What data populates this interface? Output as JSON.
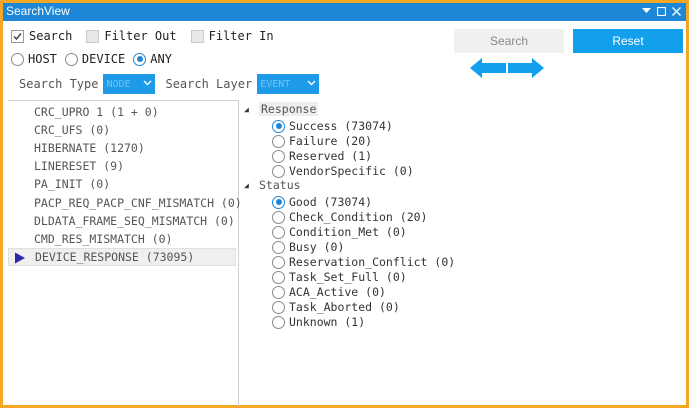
{
  "window": {
    "title": "SearchView"
  },
  "options": {
    "search": {
      "label": "Search",
      "checked": true
    },
    "filter_out": {
      "label": "Filter Out",
      "checked": false
    },
    "filter_in": {
      "label": "Filter In",
      "checked": false
    }
  },
  "scope": {
    "host": "HOST",
    "device": "DEVICE",
    "any": "ANY",
    "selected": "ANY"
  },
  "search_type": {
    "label": "Search Type",
    "value": "NODE"
  },
  "search_layer": {
    "label": "Search Layer",
    "value": "EVENT"
  },
  "buttons": {
    "search": "Search",
    "reset": "Reset"
  },
  "events": [
    {
      "label": "CRC_UPRO 1 (1 + 0)"
    },
    {
      "label": "CRC_UFS (0)"
    },
    {
      "label": "HIBERNATE (1270)"
    },
    {
      "label": "LINERESET (9)"
    },
    {
      "label": "PA_INIT (0)"
    },
    {
      "label": "PACP_REQ_PACP_CNF_MISMATCH (0)"
    },
    {
      "label": "DLDATA_FRAME_SEQ_MISMATCH (0)"
    },
    {
      "label": "CMD_RES_MISMATCH (0)"
    },
    {
      "label": "DEVICE_RESPONSE (73095)",
      "selected": true
    }
  ],
  "groups": {
    "response": {
      "label": "Response",
      "options": [
        {
          "label": "Success (73074)",
          "selected": true
        },
        {
          "label": "Failure (20)"
        },
        {
          "label": "Reserved (1)"
        },
        {
          "label": "VendorSpecific (0)"
        }
      ]
    },
    "status": {
      "label": "Status",
      "options": [
        {
          "label": "Good (73074)",
          "selected": true
        },
        {
          "label": "Check_Condition (20)"
        },
        {
          "label": "Condition_Met (0)"
        },
        {
          "label": "Busy (0)"
        },
        {
          "label": "Reservation_Conflict (0)"
        },
        {
          "label": "Task_Set_Full (0)"
        },
        {
          "label": "ACA_Active (0)"
        },
        {
          "label": "Task_Aborted (0)"
        },
        {
          "label": "Unknown (1)"
        }
      ]
    }
  },
  "colors": {
    "accent": "#1e86d6",
    "border": "#f5a623",
    "button": "#12a0ec"
  }
}
